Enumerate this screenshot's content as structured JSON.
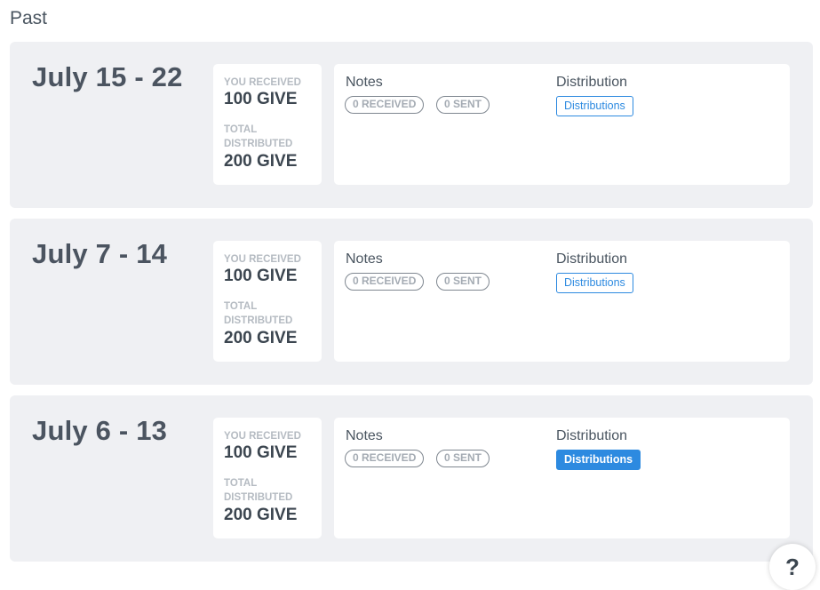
{
  "section_title": "Past",
  "labels": {
    "you_received": "YOU RECEIVED",
    "total_distributed_line1": "TOTAL",
    "total_distributed_line2": "DISTRIBUTED",
    "notes": "Notes",
    "distribution": "Distribution"
  },
  "epochs": [
    {
      "date_range": "July 15 - 22",
      "received": "100 GIVE",
      "distributed": "200 GIVE",
      "notes_received": "0 RECEIVED",
      "notes_sent": "0 SENT",
      "distributions_label": "Distributions"
    },
    {
      "date_range": "July 7 - 14",
      "received": "100 GIVE",
      "distributed": "200 GIVE",
      "notes_received": "0 RECEIVED",
      "notes_sent": "0 SENT",
      "distributions_label": "Distributions"
    },
    {
      "date_range": "July 6 - 13",
      "received": "100 GIVE",
      "distributed": "200 GIVE",
      "notes_received": "0 RECEIVED",
      "notes_sent": "0 SENT",
      "distributions_label": "Distributions"
    }
  ],
  "help": {
    "label": "?"
  },
  "colors": {
    "card_bg": "#eff0f3",
    "accent_blue": "#2d8ae0",
    "text_dark": "#3c4650",
    "label_gray": "#b5bbc2"
  }
}
